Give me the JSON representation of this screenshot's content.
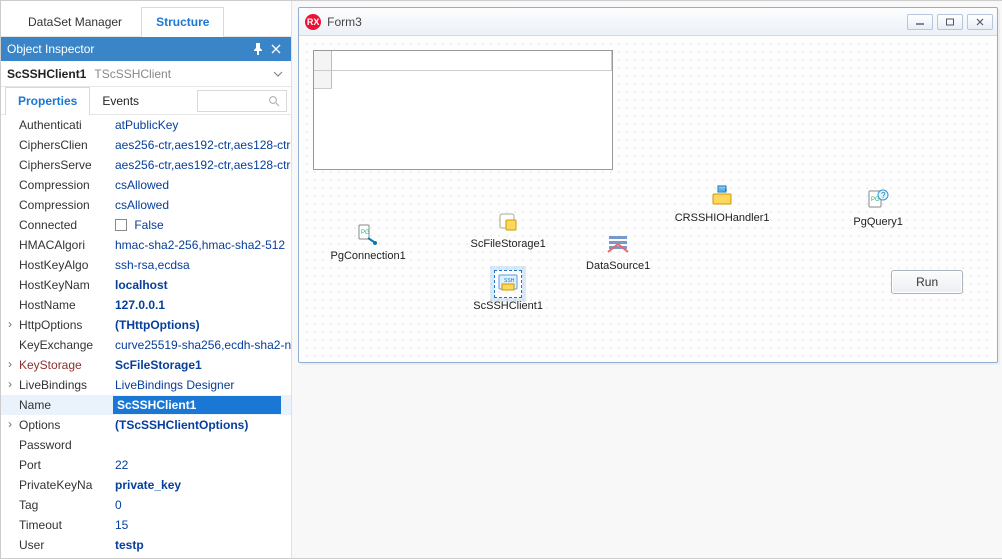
{
  "top_tabs": {
    "dataset_manager": "DataSet Manager",
    "structure": "Structure"
  },
  "object_inspector": {
    "title": "Object Inspector",
    "instance_name": "ScSSHClient1",
    "instance_type": "TScSSHClient",
    "tabs": {
      "properties": "Properties",
      "events": "Events"
    },
    "props": [
      {
        "name": "Authenticati",
        "value": "atPublicKey"
      },
      {
        "name": "CiphersClien",
        "value": "aes256-ctr,aes192-ctr,aes128-ctr"
      },
      {
        "name": "CiphersServe",
        "value": "aes256-ctr,aes192-ctr,aes128-ctr"
      },
      {
        "name": "Compression",
        "value": "csAllowed"
      },
      {
        "name": "Compression",
        "value": "csAllowed"
      },
      {
        "name": "Connected",
        "value": "False",
        "checkbox": true
      },
      {
        "name": "HMACAlgori",
        "value": "hmac-sha2-256,hmac-sha2-512"
      },
      {
        "name": "HostKeyAlgo",
        "value": "ssh-rsa,ecdsa"
      },
      {
        "name": "HostKeyNam",
        "value": "localhost",
        "bold": true
      },
      {
        "name": "HostName",
        "value": "127.0.0.1",
        "bold": true
      },
      {
        "name": "HttpOptions",
        "value": "(THttpOptions)",
        "bold": true,
        "expandable": true
      },
      {
        "name": "KeyExchange",
        "value": "curve25519-sha256,ecdh-sha2-n"
      },
      {
        "name": "KeyStorage",
        "value": "ScFileStorage1",
        "bold": true,
        "maroon": true,
        "expandable": true
      },
      {
        "name": "LiveBindings",
        "value": "LiveBindings Designer",
        "expandable": true
      },
      {
        "name": "Name",
        "value": "ScSSHClient1",
        "selected": true
      },
      {
        "name": "Options",
        "value": "(TScSSHClientOptions)",
        "bold": true,
        "expandable": true
      },
      {
        "name": "Password",
        "value": ""
      },
      {
        "name": "Port",
        "value": "22"
      },
      {
        "name": "PrivateKeyNa",
        "value": "private_key",
        "bold": true
      },
      {
        "name": "Tag",
        "value": "0"
      },
      {
        "name": "Timeout",
        "value": "15"
      },
      {
        "name": "User",
        "value": "testp",
        "bold": true
      }
    ]
  },
  "form_window": {
    "title": "Form3",
    "components": {
      "pgconnection": "PgConnection1",
      "scfilestorage": "ScFileStorage1",
      "datasource": "DataSource1",
      "crsshiohandler": "CRSSHIOHandler1",
      "pgquery": "PgQuery1",
      "scsshclient": "ScSSHClient1"
    },
    "run_button": "Run"
  }
}
